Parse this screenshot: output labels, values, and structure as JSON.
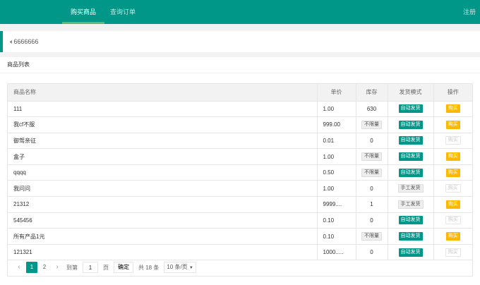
{
  "nav": {
    "buy": "购买商品",
    "query": "查询订单",
    "register": "注册"
  },
  "notice": {
    "icon": "speaker-icon",
    "text": "6666666"
  },
  "panel": {
    "title": "商品列表"
  },
  "table": {
    "headers": [
      "商品名称",
      "单价",
      "库存",
      "发货模式",
      "操作"
    ],
    "rows": [
      {
        "name": "111",
        "price": "1.00",
        "stock": "630",
        "stock_tag": false,
        "mode": "自动发货",
        "mode_type": "auto",
        "action": "购买",
        "buyable": true
      },
      {
        "name": "我cf不服",
        "price": "999.00",
        "stock": "不限量",
        "stock_tag": true,
        "mode": "自动发货",
        "mode_type": "auto",
        "action": "购买",
        "buyable": true
      },
      {
        "name": "御驾亲征",
        "price": "0.01",
        "stock": "0",
        "stock_tag": false,
        "mode": "自动发货",
        "mode_type": "auto",
        "action": "购买",
        "buyable": false
      },
      {
        "name": "盒子",
        "price": "1.00",
        "stock": "不限量",
        "stock_tag": true,
        "mode": "自动发货",
        "mode_type": "auto",
        "action": "购买",
        "buyable": true
      },
      {
        "name": "qqqq",
        "price": "0.50",
        "stock": "不限量",
        "stock_tag": true,
        "mode": "自动发货",
        "mode_type": "auto",
        "action": "购买",
        "buyable": true
      },
      {
        "name": "我问问",
        "price": "1.00",
        "stock": "0",
        "stock_tag": false,
        "mode": "手工发货",
        "mode_type": "manual",
        "action": "购买",
        "buyable": false
      },
      {
        "name": "21312",
        "price": "9999....",
        "stock": "1",
        "stock_tag": false,
        "mode": "手工发货",
        "mode_type": "manual",
        "action": "购买",
        "buyable": true
      },
      {
        "name": "545456",
        "price": "0.10",
        "stock": "0",
        "stock_tag": false,
        "mode": "自动发货",
        "mode_type": "auto",
        "action": "购买",
        "buyable": false
      },
      {
        "name": "所有产品1元",
        "price": "0.10",
        "stock": "不限量",
        "stock_tag": true,
        "mode": "自动发货",
        "mode_type": "auto",
        "action": "购买",
        "buyable": true
      },
      {
        "name": "121321",
        "price": "1000.....",
        "stock": "0",
        "stock_tag": false,
        "mode": "自动发货",
        "mode_type": "auto",
        "action": "购买",
        "buyable": false
      }
    ]
  },
  "pager": {
    "prev_icon": "chevron-left-icon",
    "next_icon": "chevron-right-icon",
    "pages": [
      "1",
      "2"
    ],
    "current": "1",
    "goto_label": "到第",
    "goto_value": "1",
    "page_unit": "页",
    "confirm": "确定",
    "total": "共 18 条",
    "page_size": "10 条/页"
  },
  "colors": {
    "primary": "#009688",
    "buy": "#ffb800",
    "nav_indicator": "#5fb878"
  }
}
